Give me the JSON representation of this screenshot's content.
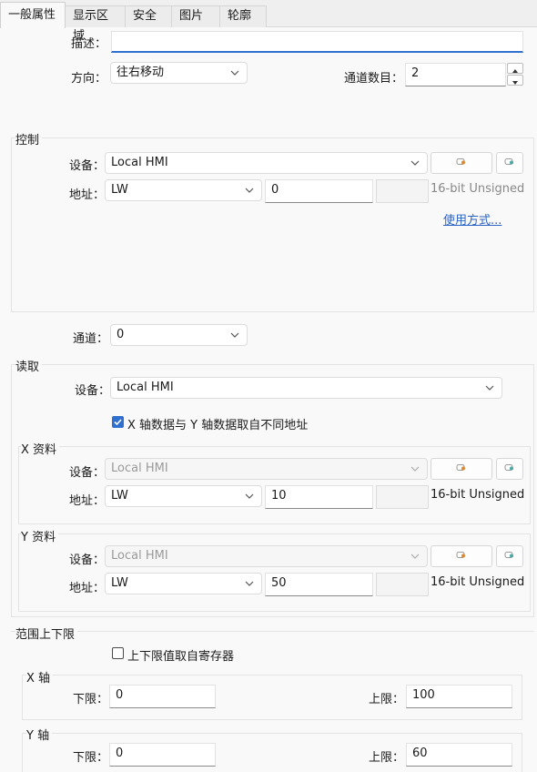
{
  "tabs": [
    {
      "label": "一般属性"
    },
    {
      "label": "显示区域"
    },
    {
      "label": "安全"
    },
    {
      "label": "图片"
    },
    {
      "label": "轮廓"
    }
  ],
  "general": {
    "description_label": "描述：",
    "description_value": "",
    "direction_label": "方向：",
    "direction_value": "往右移动",
    "channels_label": "通道数目：",
    "channels_value": "2"
  },
  "control": {
    "title": "控制",
    "device_label": "设备：",
    "device_value": "Local HMI",
    "address_label": "地址：",
    "address_type": "LW",
    "address_value": "0",
    "data_format": "16-bit Unsigned",
    "usage_link": "使用方式..."
  },
  "channel": {
    "label": "通道：",
    "value": "0"
  },
  "read": {
    "title": "读取",
    "device_label": "设备：",
    "device_value": "Local HMI",
    "separate_address_label": "X 轴数据与 Y 轴数据取自不同地址",
    "separate_address_checked": true,
    "x_data": {
      "title": "X 资料",
      "device_label": "设备：",
      "device_value": "Local HMI",
      "address_label": "地址：",
      "address_type": "LW",
      "address_value": "10",
      "data_format": "16-bit Unsigned"
    },
    "y_data": {
      "title": "Y 资料",
      "device_label": "设备：",
      "device_value": "Local HMI",
      "address_label": "地址：",
      "address_type": "LW",
      "address_value": "50",
      "data_format": "16-bit Unsigned"
    }
  },
  "limits": {
    "title": "范围上下限",
    "from_register_label": "上下限值取自寄存器",
    "from_register_checked": false,
    "x_axis": {
      "title": "X 轴",
      "lower_label": "下限：",
      "lower_value": "0",
      "upper_label": "上限：",
      "upper_value": "100"
    },
    "y_axis": {
      "title": "Y 轴",
      "lower_label": "下限：",
      "lower_value": "0",
      "upper_label": "上限：",
      "upper_value": "60"
    }
  },
  "colors": {
    "accent": "#2f6fcf",
    "link": "#2a63c5",
    "background": "#f9f9f9"
  }
}
